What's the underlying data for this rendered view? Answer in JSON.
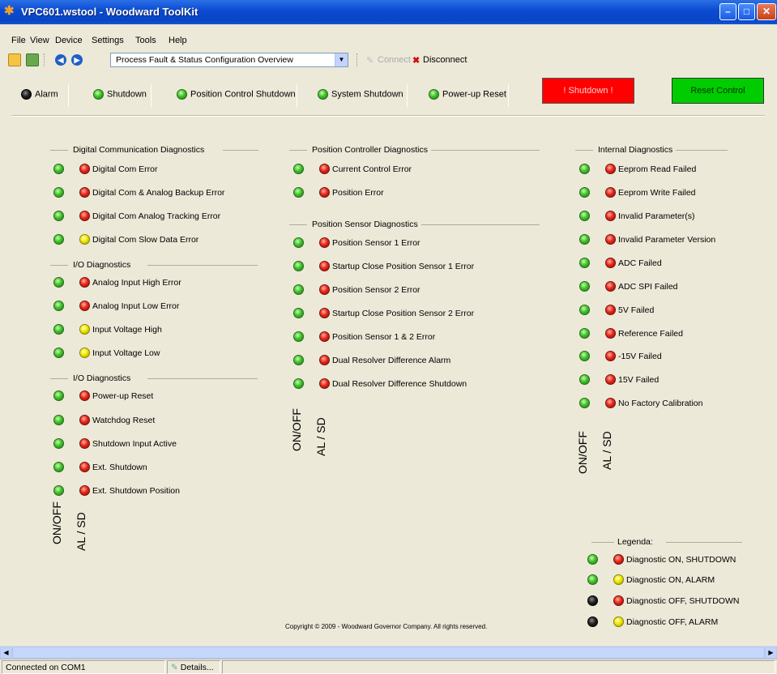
{
  "window": {
    "title": "VPC601.wstool - Woodward ToolKit"
  },
  "menu": [
    "File",
    "View",
    "Device",
    "Settings",
    "Tools",
    "Help"
  ],
  "toolbar": {
    "page": "Process Fault & Status Configuration Overview",
    "connect": "Connect",
    "disconnect": "Disconnect"
  },
  "status": {
    "alarm": "Alarm",
    "shutdown": "Shutdown",
    "position_control_shutdown": "Position Control Shutdown",
    "system_shutdown": "System Shutdown",
    "powerup_reset": "Power-up Reset",
    "shutdown_button": "! Shutdown !",
    "reset_button": "Reset Control"
  },
  "groups": {
    "digital_comm": {
      "title": "Digital Communication Diagnostics",
      "items": [
        "Digital Com Error",
        "Digital Com & Analog Backup Error",
        "Digital Com Analog Tracking Error",
        "Digital Com Slow Data Error"
      ]
    },
    "io1": {
      "title": "I/O Diagnostics",
      "items": [
        "Analog Input High Error",
        "Analog Input Low Error",
        "Input Voltage High",
        "Input Voltage Low"
      ]
    },
    "io2": {
      "title": "I/O Diagnostics",
      "items": [
        "Power-up Reset",
        "Watchdog Reset",
        "Shutdown Input Active",
        "Ext. Shutdown",
        "Ext. Shutdown Position"
      ]
    },
    "pos_ctrl": {
      "title": "Position Controller Diagnostics",
      "items": [
        "Current Control Error",
        "Position Error"
      ]
    },
    "pos_sensor": {
      "title": "Position Sensor Diagnostics",
      "items": [
        "Position Sensor 1 Error",
        "Startup Close Position Sensor 1 Error",
        "Position Sensor 2 Error",
        "Startup Close Position Sensor 2 Error",
        "Position Sensor 1 & 2 Error",
        "Dual Resolver Difference Alarm",
        "Dual Resolver Difference Shutdown"
      ]
    },
    "internal": {
      "title": "Internal Diagnostics",
      "items": [
        "Eeprom Read Failed",
        "Eeprom Write Failed",
        "Invalid Parameter(s)",
        "Invalid Parameter Version",
        "ADC Failed",
        "ADC SPI Failed",
        "5V Failed",
        "Reference Failed",
        "-15V Failed",
        "15V Failed",
        "No Factory Calibration"
      ]
    }
  },
  "axis_labels": {
    "onoff": "ON/OFF",
    "alsd": "AL / SD"
  },
  "legend": {
    "title": "Legenda:",
    "items": [
      "Diagnostic ON, SHUTDOWN",
      "Diagnostic ON, ALARM",
      "Diagnostic OFF, SHUTDOWN",
      "Diagnostic OFF, ALARM"
    ]
  },
  "copyright": "Copyright © 2009 - Woodward Governor Company. All rights reserved.",
  "statusbar": {
    "connection": "Connected on COM1",
    "details": "Details..."
  },
  "colors": {
    "shutdown_button": "#ff0000",
    "reset_button": "#00cc00",
    "titlebar": "#0a4ad0"
  }
}
